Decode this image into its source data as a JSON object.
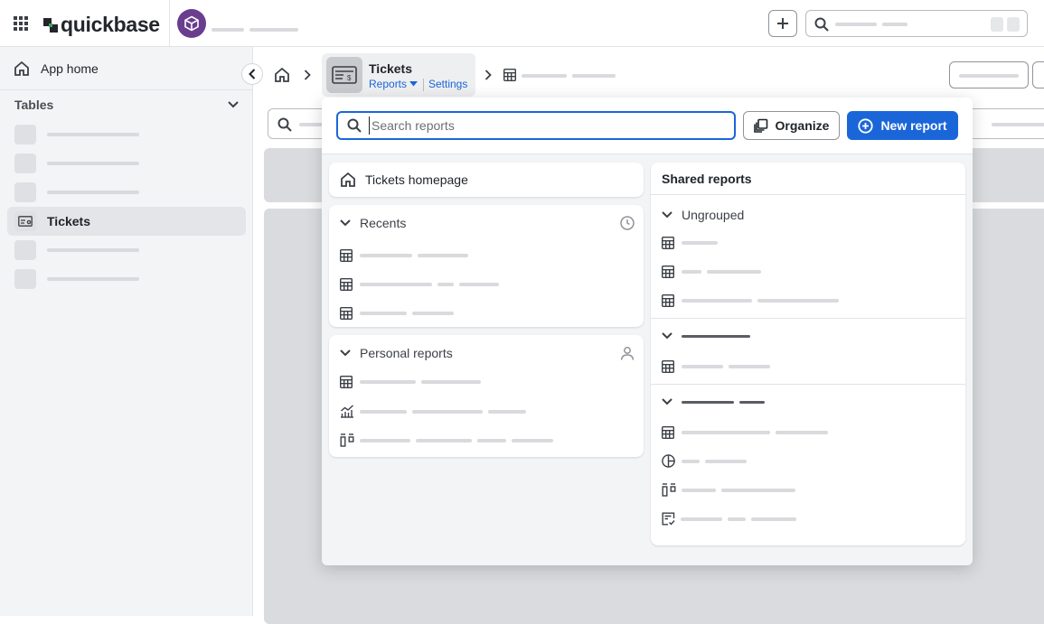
{
  "brand": {
    "name": "quickbase"
  },
  "sidebar": {
    "app_home_label": "App home",
    "tables_title": "Tables",
    "active_table": "Tickets"
  },
  "breadcrumb": {
    "table_name": "Tickets",
    "reports_link": "Reports",
    "settings_link": "Settings"
  },
  "reports_panel": {
    "search_placeholder": "Search reports",
    "search_value": "",
    "organize_label": "Organize",
    "new_report_label": "New report",
    "homepage_label": "Tickets homepage",
    "recents_title": "Recents",
    "personal_title": "Personal reports",
    "shared_title": "Shared reports",
    "ungrouped_title": "Ungrouped"
  },
  "icons": {
    "apps": "apps-grid-icon",
    "home": "home-icon",
    "search": "search-icon",
    "table": "table-icon",
    "chart": "chart-icon",
    "kanban": "kanban-icon",
    "pie": "pie-chart-icon",
    "form": "form-list-icon",
    "clock": "clock-icon",
    "user": "user-icon",
    "chevron": "chevron-down-icon"
  },
  "colors": {
    "accent": "#1a66d9",
    "app_avatar": "#6a3e8f",
    "sidebar_bg": "#f3f4f6"
  }
}
